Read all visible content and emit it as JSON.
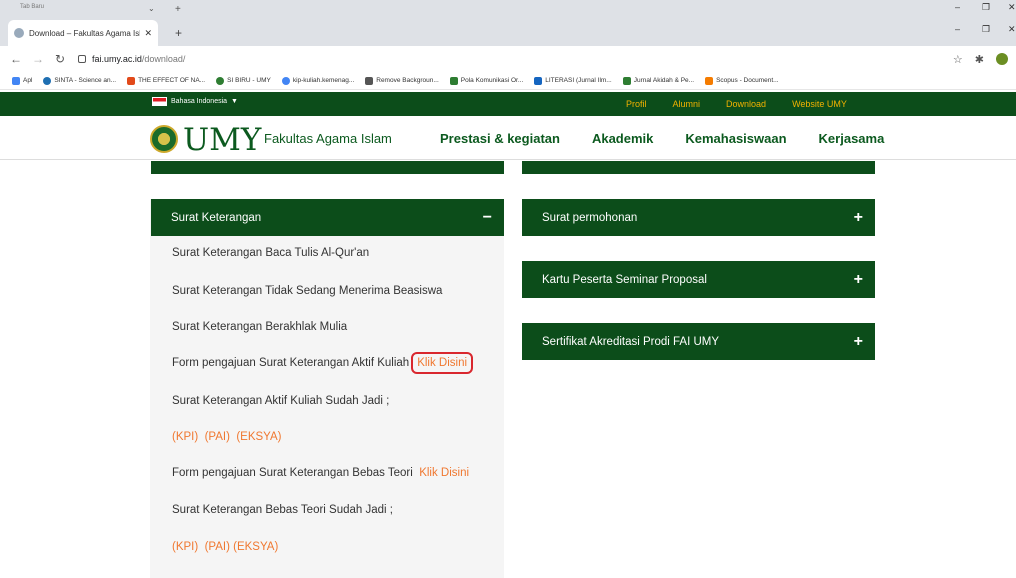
{
  "browser": {
    "ghost_tab_label": "Tab Baru",
    "tab_title": "Download – Fakultas Agama Isla",
    "url_host": "fai.umy.ac.id",
    "url_path": "/download/",
    "bookmarks": [
      {
        "label": "Apl",
        "color": "#4285f4"
      },
      {
        "label": "SINTA - Science an...",
        "color": "#1f6fb2"
      },
      {
        "label": "THE EFFECT OF NA...",
        "color": "#e24a1a"
      },
      {
        "label": "SI BIRU - UMY",
        "color": "#2e7d32"
      },
      {
        "label": "kip-kuliah.kemenag...",
        "color": "#4285f4"
      },
      {
        "label": "Remove Backgroun...",
        "color": "#555555"
      },
      {
        "label": "Pola Komunikasi Or...",
        "color": "#2e7d32"
      },
      {
        "label": "LITERASI (Jurnal Ilm...",
        "color": "#1565c0"
      },
      {
        "label": "Jurnal Akidah & Pe...",
        "color": "#2e7d32"
      },
      {
        "label": "Scopus - Document...",
        "color": "#f57c00"
      }
    ]
  },
  "site": {
    "language": "Bahasa Indonesia",
    "top_nav": [
      "Profil",
      "Alumni",
      "Download",
      "Website UMY"
    ],
    "logo_text": "UMY",
    "logo_sub": "Fakultas Agama Islam",
    "main_nav": [
      "Prestasi & kegiatan",
      "Akademik",
      "Kemahasiswaan",
      "Kerjasama"
    ]
  },
  "left_panel": {
    "title": "Surat Keterangan",
    "sign": "−",
    "items": {
      "baca_tulis": "Surat Keterangan Baca Tulis Al-Qur'an",
      "tidak_beasiswa": "Surat Keterangan Tidak Sedang Menerima Beasiswa",
      "berakhlak": "Surat Keterangan Berakhlak Mulia",
      "form_aktif": "Form pengajuan Surat Keterangan Aktif Kuliah",
      "aktif_jadi": "Surat Keterangan Aktif Kuliah Sudah Jadi ;",
      "form_bebas": "Form pengajuan Surat Keterangan Bebas Teori",
      "bebas_jadi": "Surat Keterangan Bebas Teori Sudah Jadi ;"
    },
    "klik_disini": "Klik Disini",
    "links_row1": [
      "(KPI)",
      "(PAI)",
      "(EKSYA)"
    ],
    "links_row2": [
      "(KPI)",
      "(PAI)",
      "(EKSYA)"
    ]
  },
  "right_panels": [
    {
      "title": "Surat permohonan",
      "sign": "+"
    },
    {
      "title": "Kartu Peserta Seminar Proposal",
      "sign": "+"
    },
    {
      "title": "Sertifikat Akreditasi Prodi FAI UMY",
      "sign": "+"
    }
  ]
}
